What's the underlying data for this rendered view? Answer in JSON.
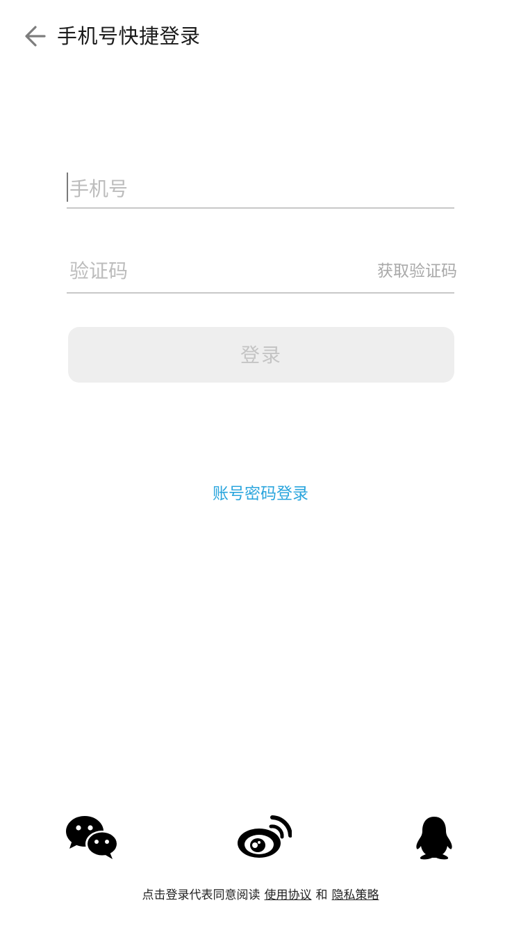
{
  "header": {
    "back_icon": "arrow-left-icon",
    "title": "手机号快捷登录"
  },
  "form": {
    "phone_placeholder": "手机号",
    "phone_value": "",
    "code_placeholder": "验证码",
    "code_value": "",
    "get_code_label": "获取验证码",
    "login_label": "登录"
  },
  "alt_login": {
    "password_login_label": "账号密码登录"
  },
  "social": {
    "icons": [
      "wechat-icon",
      "weibo-icon",
      "qq-icon"
    ]
  },
  "agreement": {
    "prefix": "点击登录代表同意阅读",
    "terms_label": "使用协议",
    "joiner": "和",
    "privacy_label": "隐私策略"
  },
  "colors": {
    "link_blue": "#2aa5dd",
    "button_bg": "#eeeeee",
    "placeholder": "#bcbcbc"
  }
}
